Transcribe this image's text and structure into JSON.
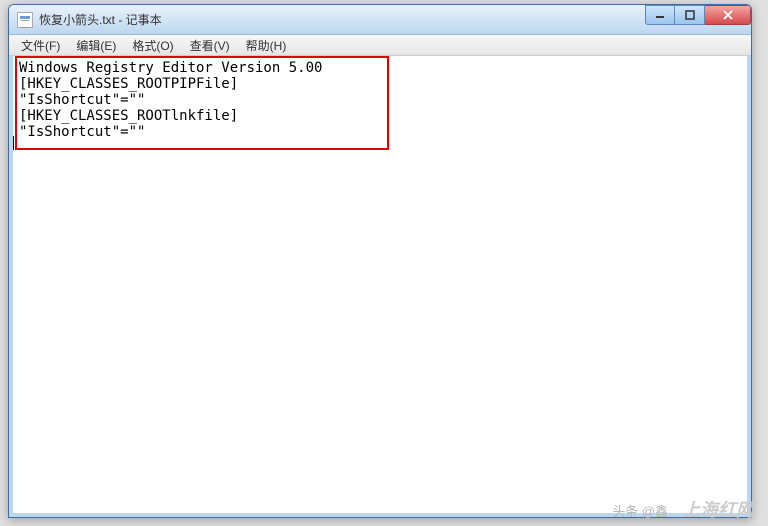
{
  "title": "恢复小箭头.txt - 记事本",
  "menu": {
    "file": "文件(F)",
    "edit": "编辑(E)",
    "format": "格式(O)",
    "view": "查看(V)",
    "help": "帮助(H)"
  },
  "content": "Windows Registry Editor Version 5.00\n[HKEY_CLASSES_ROOTPIPFile]\n\"IsShortcut\"=\"\"\n[HKEY_CLASSES_ROOTlnkfile]\n\"IsShortcut\"=\"\"",
  "watermark_prefix": "头条 @鑫",
  "watermark_suffix": "上海红网"
}
